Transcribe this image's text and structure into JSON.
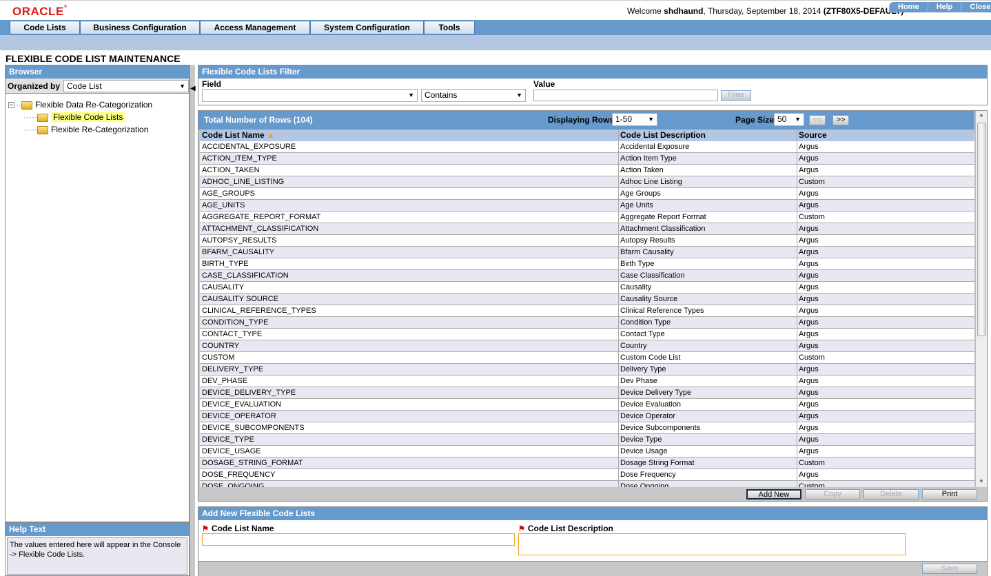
{
  "header": {
    "logo": "ORACLE",
    "welcome_prefix": "Welcome ",
    "user": "shdhaund",
    "date_text": ", Thursday, September 18, 2014 ",
    "enterprise": "(ZTF80X5-DEFAULT)",
    "links": [
      "Home",
      "Help",
      "Close"
    ]
  },
  "menu": [
    "Code Lists",
    "Business Configuration",
    "Access Management",
    "System Configuration",
    "Tools"
  ],
  "page_title": "FLEXIBLE CODE LIST MAINTENANCE",
  "browser": {
    "title": "Browser",
    "organized_by_label": "Organized by",
    "organized_by_value": "Code List",
    "tree": [
      {
        "label": "Flexible Data Re-Categorization",
        "level": 0,
        "expanded": true
      },
      {
        "label": "Flexible Code Lists",
        "level": 1,
        "selected": true
      },
      {
        "label": "Flexible Re-Categorization",
        "level": 1
      }
    ]
  },
  "help": {
    "title": "Help Text",
    "text": "The values entered here will appear in the Console -> Flexible Code Lists."
  },
  "filter": {
    "title": "Flexible Code Lists Filter",
    "field_label": "Field",
    "field_value": "",
    "operator_value": "Contains",
    "value_label": "Value",
    "value": "",
    "filter_button": "Filter"
  },
  "grid": {
    "total_rows_label": "Total Number of Rows (104)",
    "displaying_label": "Displaying Rows",
    "displaying_value": "1-50",
    "page_size_label": "Page Size",
    "page_size_value": "50",
    "prev_label": "<<",
    "next_label": ">>",
    "columns": [
      "Code List Name",
      "Code List Description",
      "Source"
    ],
    "rows": [
      [
        "ACCIDENTAL_EXPOSURE",
        "Accidental Exposure",
        "Argus"
      ],
      [
        "ACTION_ITEM_TYPE",
        "Action Item Type",
        "Argus"
      ],
      [
        "ACTION_TAKEN",
        "Action Taken",
        "Argus"
      ],
      [
        "ADHOC_LINE_LISTING",
        "Adhoc Line Listing",
        "Custom"
      ],
      [
        "AGE_GROUPS",
        "Age Groups",
        "Argus"
      ],
      [
        "AGE_UNITS",
        "Age Units",
        "Argus"
      ],
      [
        "AGGREGATE_REPORT_FORMAT",
        "Aggregate Report Format",
        "Custom"
      ],
      [
        "ATTACHMENT_CLASSIFICATION",
        "Attachment Classification",
        "Argus"
      ],
      [
        "AUTOPSY_RESULTS",
        "Autopsy Results",
        "Argus"
      ],
      [
        "BFARM_CAUSALITY",
        "Bfarm Causality",
        "Argus"
      ],
      [
        "BIRTH_TYPE",
        "Birth Type",
        "Argus"
      ],
      [
        "CASE_CLASSIFICATION",
        "Case Classification",
        "Argus"
      ],
      [
        "CAUSALITY",
        "Causality",
        "Argus"
      ],
      [
        "CAUSALITY SOURCE",
        "Causality Source",
        "Argus"
      ],
      [
        "CLINICAL_REFERENCE_TYPES",
        "Clinical Reference Types",
        "Argus"
      ],
      [
        "CONDITION_TYPE",
        "Condition Type",
        "Argus"
      ],
      [
        "CONTACT_TYPE",
        "Contact Type",
        "Argus"
      ],
      [
        "COUNTRY",
        "Country",
        "Argus"
      ],
      [
        "CUSTOM",
        "Custom Code List",
        "Custom"
      ],
      [
        "DELIVERY_TYPE",
        "Delivery Type",
        "Argus"
      ],
      [
        "DEV_PHASE",
        "Dev Phase",
        "Argus"
      ],
      [
        "DEVICE_DELIVERY_TYPE",
        "Device Delivery Type",
        "Argus"
      ],
      [
        "DEVICE_EVALUATION",
        "Device Evaluation",
        "Argus"
      ],
      [
        "DEVICE_OPERATOR",
        "Device Operator",
        "Argus"
      ],
      [
        "DEVICE_SUBCOMPONENTS",
        "Device Subcomponents",
        "Argus"
      ],
      [
        "DEVICE_TYPE",
        "Device Type",
        "Argus"
      ],
      [
        "DEVICE_USAGE",
        "Device Usage",
        "Argus"
      ],
      [
        "DOSAGE_STRING_FORMAT",
        "Dosage String Format",
        "Custom"
      ],
      [
        "DOSE_FREQUENCY",
        "Dose Frequency",
        "Argus"
      ],
      [
        "DOSE_ONGOING",
        "Dose Ongoing",
        "Custom"
      ]
    ],
    "buttons": {
      "add_new": "Add New",
      "copy": "Copy",
      "delete": "Delete",
      "print": "Print"
    }
  },
  "add_new": {
    "title": "Add New Flexible Code Lists",
    "name_label": "Code List Name",
    "name_value": "",
    "description_label": "Code List Description",
    "description_value": "",
    "save_button": "Save"
  },
  "colors": {
    "header_blue": "#6699cc",
    "subbar": "#b3c6e2",
    "logo_red": "#e01b14",
    "required_border": "#f0a020"
  }
}
